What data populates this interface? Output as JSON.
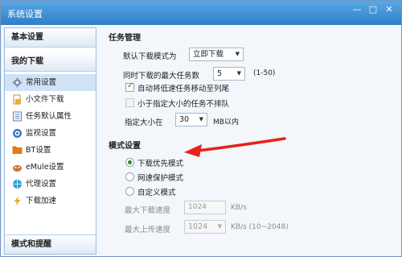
{
  "window": {
    "title": "系统设置",
    "min_symbol": "—",
    "max_symbol": "□",
    "close_symbol": "✕"
  },
  "sidebar": {
    "top_header": "基本设置",
    "group_header": "我的下载",
    "items": [
      {
        "label": "常用设置",
        "icon": "gear-icon",
        "selected": true
      },
      {
        "label": "小文件下载",
        "icon": "small-file-icon"
      },
      {
        "label": "任务默认属性",
        "icon": "document-icon"
      },
      {
        "label": "监视设置",
        "icon": "monitor-icon"
      },
      {
        "label": "BT设置",
        "icon": "bt-icon"
      },
      {
        "label": "eMule设置",
        "icon": "emule-icon"
      },
      {
        "label": "代理设置",
        "icon": "proxy-icon"
      },
      {
        "label": "下载加速",
        "icon": "lightning-icon"
      }
    ],
    "bottom_header": "模式和提醒"
  },
  "task": {
    "title": "任务管理",
    "default_mode_label": "默认下载模式为",
    "default_mode_value": "立即下载",
    "max_tasks_label": "同时下载的最大任务数",
    "max_tasks_value": "5",
    "max_tasks_range": "(1-50)",
    "auto_move_label": "自动将低速任务移动至列尾",
    "auto_move_checked": true,
    "no_queue_label": "小于指定大小的任务不排队",
    "size_label": "指定大小在",
    "size_value": "30",
    "size_unit": "MB以内"
  },
  "mode": {
    "title": "模式设置",
    "options": [
      "下载优先模式",
      "网速保护模式",
      "自定义模式"
    ],
    "selected": 0,
    "max_down_label": "最大下载速度",
    "max_down_value": "1024",
    "max_down_unit": "KB/s",
    "max_up_label": "最大上传速度",
    "max_up_value": "1024",
    "max_up_unit": "KB/s (10~2048)"
  },
  "colors": {
    "annotation_arrow": "#e8221b",
    "titlebar": "#2f7fc8"
  }
}
